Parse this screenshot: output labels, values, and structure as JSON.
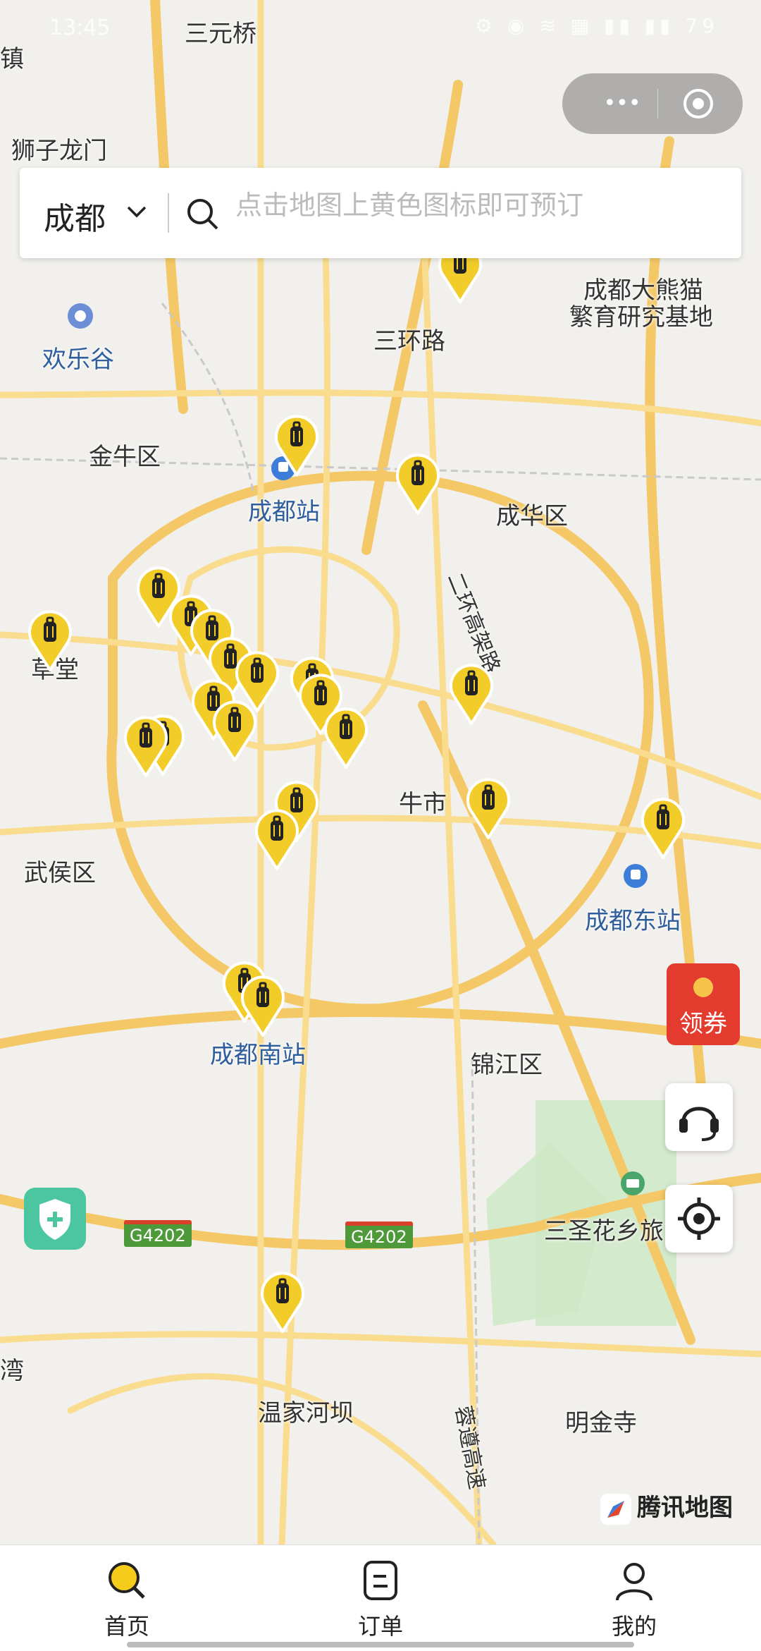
{
  "status": {
    "time": "13:45",
    "icons": "⚙ ◉ ≋ ▦ ▮▮ ▮▮ 79"
  },
  "capsule": {
    "more": "•••"
  },
  "search": {
    "city": "成都",
    "placeholder": "点击地图上黄色图标即可预订"
  },
  "map_labels": [
    {
      "text": "三元桥",
      "style": ""
    },
    {
      "text": "狮子龙门",
      "style": ""
    },
    {
      "text": "镇",
      "style": ""
    },
    {
      "text": "欢乐谷",
      "style": "blue"
    },
    {
      "text": "三环路",
      "style": ""
    },
    {
      "text": "成都大熊猫",
      "style": ""
    },
    {
      "text": "繁育研究基地",
      "style": ""
    },
    {
      "text": "金牛区",
      "style": ""
    },
    {
      "text": "成都站",
      "style": "blue"
    },
    {
      "text": "成华区",
      "style": ""
    },
    {
      "text": "二环高架路",
      "style": "small"
    },
    {
      "text": "草堂",
      "style": ""
    },
    {
      "text": "牛市",
      "style": ""
    },
    {
      "text": "武侯区",
      "style": ""
    },
    {
      "text": "成都东站",
      "style": "blue"
    },
    {
      "text": "成都南站",
      "style": "blue"
    },
    {
      "text": "锦江区",
      "style": ""
    },
    {
      "text": "三圣花乡旅",
      "style": ""
    },
    {
      "text": "湾",
      "style": ""
    },
    {
      "text": "温家河坝",
      "style": ""
    },
    {
      "text": "明金寺",
      "style": ""
    },
    {
      "text": "蓉遵高速",
      "style": "small"
    }
  ],
  "road_signs": [
    "G4202",
    "G4202"
  ],
  "coupon_label": "领券",
  "brand": "腾讯地图",
  "tabs": [
    {
      "label": "首页",
      "icon": "search-icon"
    },
    {
      "label": "订单",
      "icon": "order-icon"
    },
    {
      "label": "我的",
      "icon": "user-icon"
    }
  ],
  "colors": {
    "accent": "#f5cc1b",
    "pin": "#f2cd2a",
    "coupon": "#e33b2e",
    "shield": "#4bc6a0"
  }
}
